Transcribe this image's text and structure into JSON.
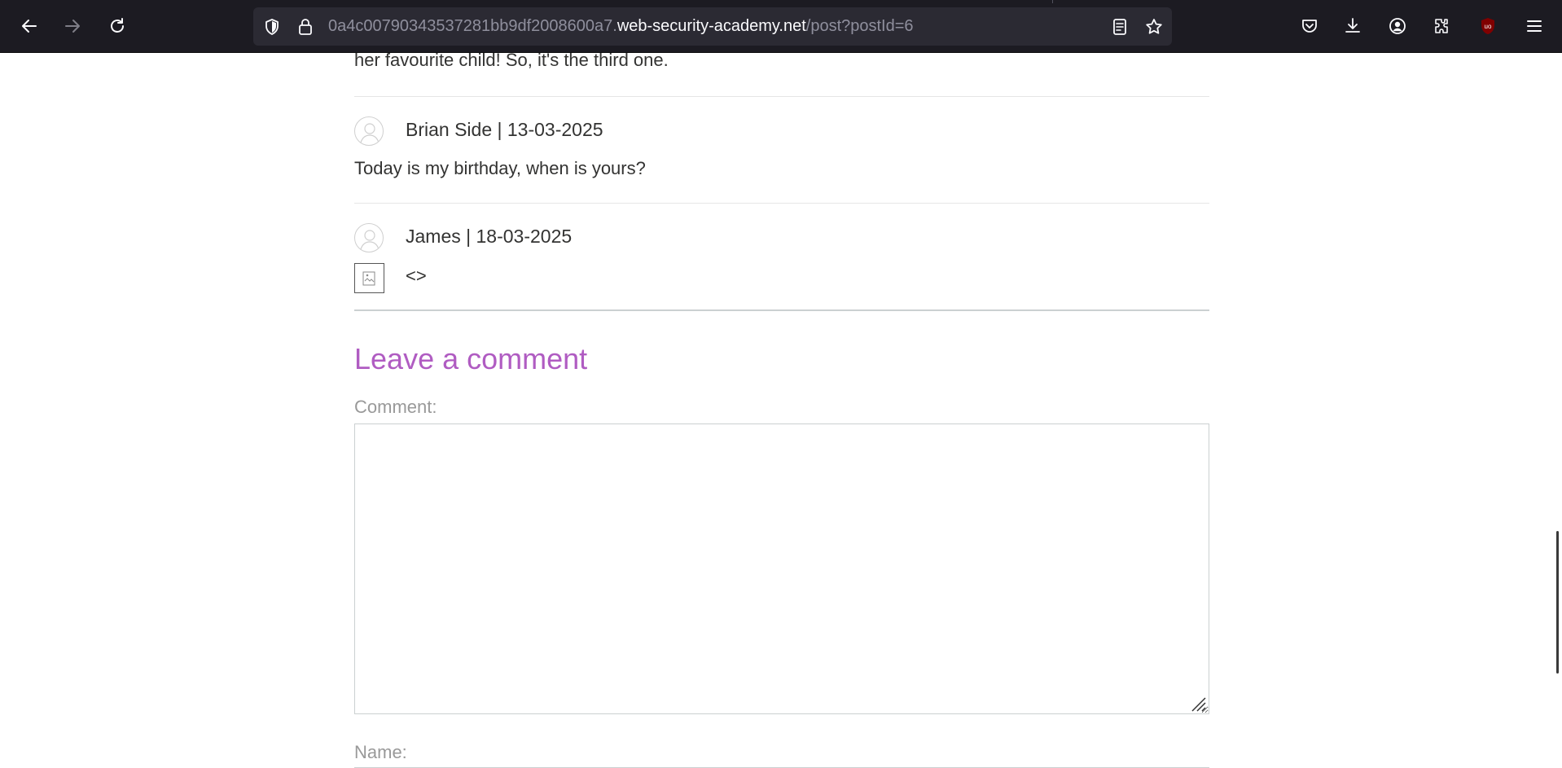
{
  "browser": {
    "url": {
      "prefix": "0a4c00790343537281bb9df2008600a7.",
      "domain": "web-security-academy.net",
      "path": "/post?postId=6"
    },
    "icons": {
      "back": "back-arrow-icon",
      "forward": "forward-arrow-icon",
      "reload": "reload-icon",
      "shield": "tracking-protection-shield-icon",
      "lock": "lock-icon",
      "reader": "reader-view-icon",
      "bookmark": "bookmark-star-icon",
      "pocket": "pocket-icon",
      "downloads": "download-icon",
      "account": "account-icon",
      "extensions": "extensions-puzzle-icon",
      "ublock": "ublock-origin-icon",
      "menu": "hamburger-menu-icon"
    },
    "ublock_badge": "uo",
    "colors": {
      "toolbar_bg": "#1c1b22",
      "urlbar_bg": "#2b2a33",
      "ublock_red": "#800000"
    }
  },
  "page": {
    "prev_comment_tail": "her favourite child! So, it's the third one.",
    "comments": [
      {
        "author_date": "Brian Side | 13-03-2025",
        "body": "Today is my birthday, when is yours?"
      },
      {
        "author_date": "James | 18-03-2025",
        "body": "<>"
      }
    ],
    "form": {
      "heading": "Leave a comment",
      "comment_label": "Comment:",
      "name_label": "Name:",
      "comment_value": ""
    },
    "colors": {
      "heading": "#b05cc2",
      "label": "#999999",
      "text": "#333332"
    }
  }
}
